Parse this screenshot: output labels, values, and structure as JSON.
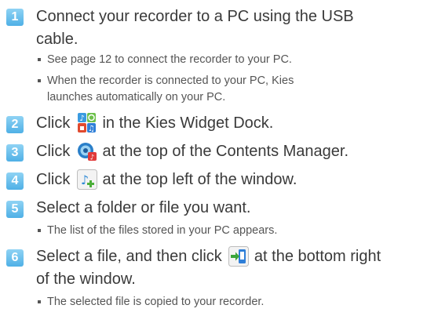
{
  "steps": [
    {
      "number": "1",
      "text_line1": "Connect your recorder to a PC using the USB",
      "text_line2": "cable.",
      "notes": [
        {
          "line1": "See page 12 to connect the recorder to your PC."
        },
        {
          "line1": "When the recorder is connected to your PC, Kies",
          "line2": "launches automatically on your PC."
        }
      ]
    },
    {
      "number": "2",
      "before": "Click",
      "after": "in the Kies Widget Dock.",
      "icon": "widget-dock-icon"
    },
    {
      "number": "3",
      "before": "Click",
      "after": "at the top of the Contents Manager.",
      "icon": "contents-manager-icon"
    },
    {
      "number": "4",
      "before": "Click",
      "after": "at the top left of the window.",
      "icon": "add-music-icon"
    },
    {
      "number": "5",
      "text": "Select a folder or file you want.",
      "notes": [
        {
          "line1": "The list of the files stored in your PC appears."
        }
      ]
    },
    {
      "number": "6",
      "before": "Select a file, and then click",
      "after": "at the bottom right",
      "line2": "of the window.",
      "icon": "transfer-to-device-icon",
      "notes": [
        {
          "line1": "The selected file is copied to your recorder."
        }
      ]
    }
  ],
  "colors": {
    "badge": "#5bb6ea",
    "text": "#3a3a3a"
  }
}
